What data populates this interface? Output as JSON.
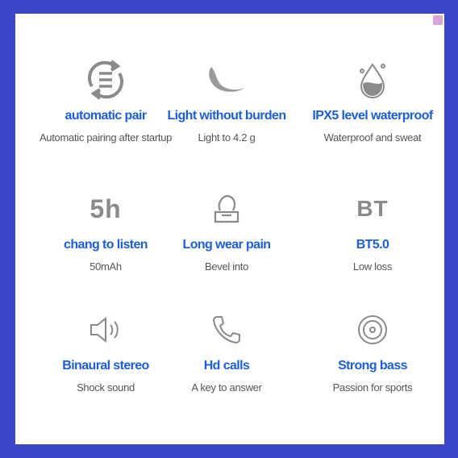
{
  "features": [
    {
      "icon": "sync-icon",
      "title": "automatic pair",
      "subtitle": "Automatic pairing after startup"
    },
    {
      "icon": "feather-icon",
      "title": "Light without burden",
      "subtitle": "Light to 4.2 g"
    },
    {
      "icon": "water-drop-icon",
      "title": "IPX5 level waterproof",
      "subtitle": "Waterproof and sweat"
    },
    {
      "icon": "5h-text-icon",
      "icon_text": "5h",
      "title": "chang to listen",
      "subtitle": "50mAh"
    },
    {
      "icon": "earbud-case-icon",
      "title": "Long wear pain",
      "subtitle": "Bevel into"
    },
    {
      "icon": "bt-text-icon",
      "icon_text": "BT",
      "title": "BT5.0",
      "subtitle": "Low loss"
    },
    {
      "icon": "speaker-icon",
      "title": "Binaural stereo",
      "subtitle": "Shock sound"
    },
    {
      "icon": "phone-icon",
      "title": "Hd calls",
      "subtitle": "A key to answer"
    },
    {
      "icon": "disc-icon",
      "title": "Strong bass",
      "subtitle": "Passion for sports"
    }
  ],
  "colors": {
    "border": "#3c46c8",
    "title": "#1c5fd4",
    "subtitle": "#555555",
    "icon": "#8a8a8a"
  }
}
